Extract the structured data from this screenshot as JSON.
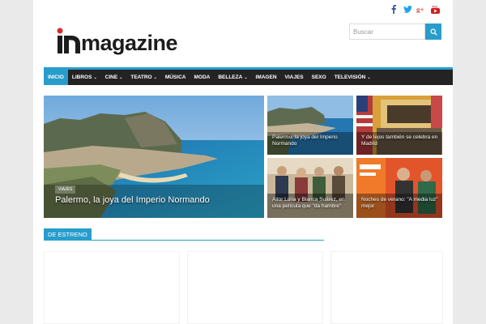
{
  "brand": {
    "logo_text": "magazine",
    "accent": "#289dcc",
    "logo_red": "#d92b2b",
    "nav_bg": "#232323"
  },
  "social": [
    {
      "icon": "facebook-icon",
      "glyph": "f",
      "color": "#3b5998"
    },
    {
      "icon": "twitter-icon",
      "glyph": "t",
      "color": "#1da1f2"
    },
    {
      "icon": "google-plus-icon",
      "glyph": "g+",
      "color": "#dd4b39"
    },
    {
      "icon": "youtube-icon",
      "glyph": "▶",
      "color": "#cd201f"
    }
  ],
  "search": {
    "placeholder": "Buscar"
  },
  "nav": [
    {
      "label": "INICIO",
      "active": true,
      "dropdown": false
    },
    {
      "label": "LIBROS",
      "active": false,
      "dropdown": true
    },
    {
      "label": "CINE",
      "active": false,
      "dropdown": true
    },
    {
      "label": "TEATRO",
      "active": false,
      "dropdown": true
    },
    {
      "label": "MÚSICA",
      "active": false,
      "dropdown": false
    },
    {
      "label": "MODA",
      "active": false,
      "dropdown": false
    },
    {
      "label": "BELLEZA",
      "active": false,
      "dropdown": true
    },
    {
      "label": "IMAGEN",
      "active": false,
      "dropdown": false
    },
    {
      "label": "VIAJES",
      "active": false,
      "dropdown": false
    },
    {
      "label": "SEXO",
      "active": false,
      "dropdown": false
    },
    {
      "label": "TELEVISIÓN",
      "active": false,
      "dropdown": true
    }
  ],
  "featured": {
    "category": "VIAJES",
    "title": "Palermo, la joya del Imperio Normando"
  },
  "tiles": [
    {
      "title": "Palermo, la joya del Imperio Normando"
    },
    {
      "title": "Y de lejos también se celebra en Madrid"
    },
    {
      "title": "Aitor Luna y Blanca Suárez, en una película que \"da hambre\""
    },
    {
      "title": "Noches de verano: \"A media luz\" mejor"
    }
  ],
  "section": {
    "label": "DE ESTRENO"
  }
}
